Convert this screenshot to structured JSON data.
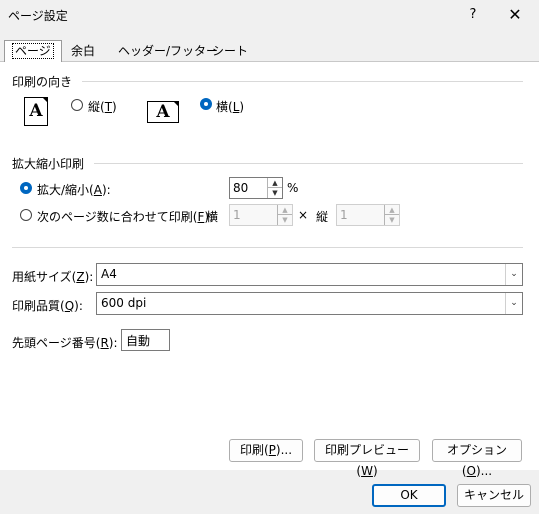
{
  "window": {
    "title": "ページ設定",
    "help": "?",
    "close": "✕"
  },
  "tabs": [
    {
      "label": "ページ"
    },
    {
      "label": "余白"
    },
    {
      "label": "ヘッダー/フッター"
    },
    {
      "label": "シート"
    }
  ],
  "orientation": {
    "heading": "印刷の向き",
    "portrait": {
      "text": "縦(",
      "key": "T",
      "end": ")",
      "checked": false
    },
    "landscape": {
      "text": "横(",
      "key": "L",
      "end": ")",
      "checked": true
    },
    "icon_letter": "A"
  },
  "scaling": {
    "heading": "拡大縮小印刷",
    "adjust": {
      "text": "拡大/縮小(",
      "key": "A",
      "end": "):",
      "checked": true,
      "value": "80",
      "unit": "%"
    },
    "fit": {
      "text": "次のページ数に合わせて印刷(",
      "key": "F",
      "end": "):",
      "checked": false,
      "wide_label": "横",
      "wide_value": "1",
      "sep": "×",
      "tall_label": "縦",
      "tall_value": "1"
    }
  },
  "paper": {
    "size_label_text": "用紙サイズ(",
    "size_key": "Z",
    "size_end": "):",
    "size_value": "A4",
    "quality_label_text": "印刷品質(",
    "quality_key": "Q",
    "quality_end": "):",
    "quality_value": "600 dpi",
    "first_page_label_text": "先頭ページ番号(",
    "first_page_key": "R",
    "first_page_end": "):",
    "first_page_value": "自動"
  },
  "buttons": {
    "print": {
      "text": "印刷(",
      "key": "P",
      "end": ")..."
    },
    "preview": {
      "text": "印刷プレビュー(",
      "key": "W",
      "end": ")"
    },
    "options": {
      "text": "オプション(",
      "key": "O",
      "end": ")..."
    },
    "ok": "OK",
    "cancel": "キャンセル"
  },
  "colors": {
    "accent": "#0067c0",
    "background": "#f0f0f0",
    "panel": "#ffffff"
  }
}
